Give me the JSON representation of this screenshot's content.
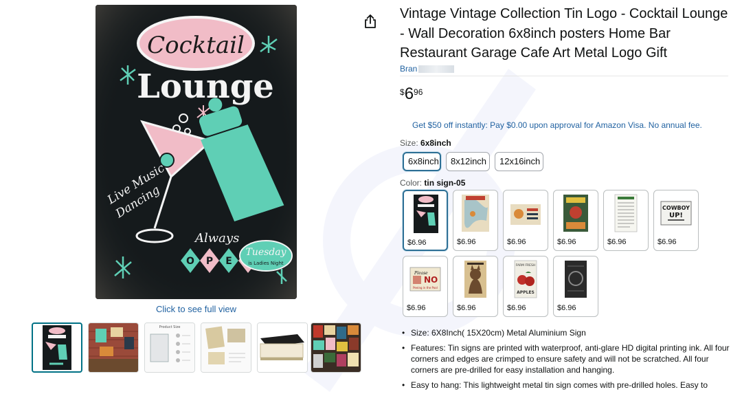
{
  "product": {
    "title": "Vintage Vintage Collection Tin Logo - Cocktail Lounge - Wall Decoration 6x8inch posters Home Bar Restaurant Garage Cafe Art Metal Logo Gift",
    "brand_label": "Bran",
    "price": {
      "symbol": "$",
      "whole": "6",
      "fraction": "96"
    },
    "promo": "Get $50 off instantly: Pay $0.00 upon approval for Amazon Visa. No annual fee."
  },
  "gallery": {
    "see_full_view": "Click to see full view",
    "main_sign": {
      "top": "Cocktail",
      "middle": "Lounge",
      "left_text_1": "Live Music",
      "left_text_2": "Dancing",
      "always": "Always",
      "open": [
        "O",
        "P",
        "E",
        "N"
      ],
      "tuesday": "Tuesday",
      "ladies": "is Ladies Night"
    },
    "thumbnail_count": 6,
    "selected_thumbnail": 0,
    "thumb3_title": "Product Size"
  },
  "size": {
    "label": "Size:",
    "selected": "6x8inch",
    "options": [
      "6x8inch",
      "8x12inch",
      "12x16inch"
    ]
  },
  "color": {
    "label": "Color:",
    "selected": "tin sign-05",
    "swatches": [
      {
        "price": "$6.96",
        "art": "lounge"
      },
      {
        "price": "$6.96",
        "art": "map"
      },
      {
        "price": "$6.96",
        "art": "burger"
      },
      {
        "price": "$6.96",
        "art": "bar"
      },
      {
        "price": "$6.96",
        "art": "list"
      },
      {
        "price": "$6.96",
        "art": "cowboy"
      },
      {
        "price": "$6.96",
        "art": "no-pool"
      },
      {
        "price": "$6.96",
        "art": "cat"
      },
      {
        "price": "$6.96",
        "art": "apples"
      },
      {
        "price": "$6.96",
        "art": "dark"
      }
    ],
    "art_text": {
      "cowboy_1": "COWBOY",
      "cowboy_2": "UP!",
      "pool_1": "Please",
      "pool_2": "NO",
      "pool_3": "Peeing in the Pool",
      "apples_1": "FARM FRESH",
      "apples_2": "APPLES",
      "burger": "BURGERS SERVED DAILY"
    }
  },
  "bullets": [
    "Size: 6X8Inch( 15X20cm) Metal Aluminium Sign",
    "Features: Tin signs are printed with waterproof, anti-glare HD digital printing ink. All four corners and edges are crimped to ensure safety and will not be scratched. All four corners are pre-drilled for easy installation and hanging.",
    "Easy to hang: This lightweight metal tin sign comes with pre-drilled holes. Easy to"
  ],
  "icons": {
    "share": "share-icon"
  },
  "colors": {
    "link": "#2162a1",
    "selected_border": "#2d6f95",
    "sign_bg": "#151a1c",
    "sign_teal": "#5fcfb5",
    "sign_pink": "#f1bcc7"
  }
}
